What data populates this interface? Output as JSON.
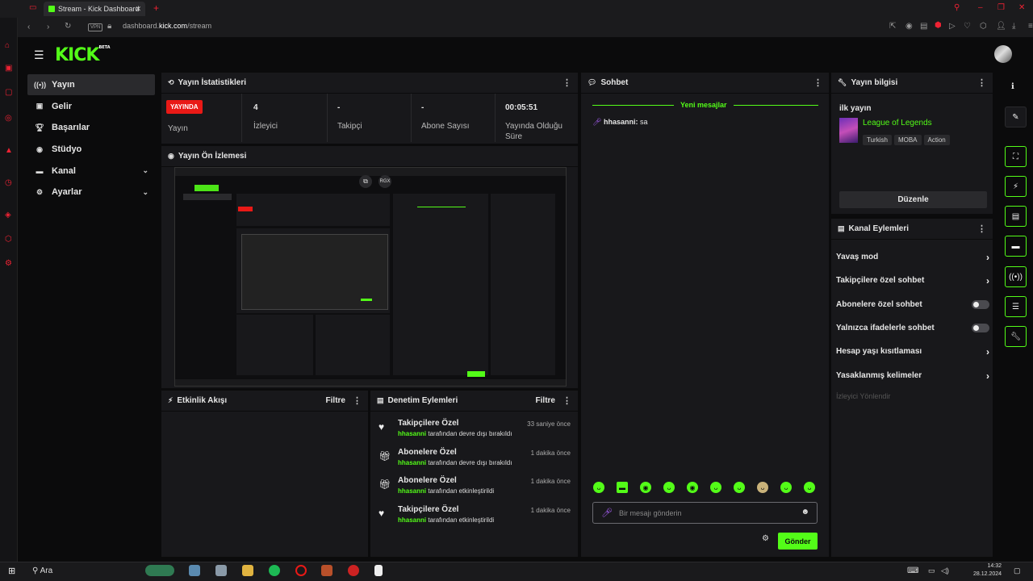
{
  "browser": {
    "tab_title": "Stream - Kick Dashboard",
    "new_tab": "+",
    "url_prefix": "dashboard.",
    "url_domain": "kick.com",
    "url_path": "/stream",
    "vpn_label": "VPN"
  },
  "brand": {
    "logo": "KICK",
    "beta": "BETA",
    "accent": "#53fc18",
    "live_red": "#e91916"
  },
  "sidebar": {
    "items": [
      {
        "label": "Yayın",
        "icon": "broadcast-icon"
      },
      {
        "label": "Gelir",
        "icon": "money-icon"
      },
      {
        "label": "Başarılar",
        "icon": "trophy-icon"
      },
      {
        "label": "Stüdyo",
        "icon": "studio-icon"
      },
      {
        "label": "Kanal",
        "icon": "channel-icon"
      },
      {
        "label": "Ayarlar",
        "icon": "gear-icon"
      }
    ]
  },
  "stats": {
    "title": "Yayın İstatistikleri",
    "live_badge": "YAYINDA",
    "live_label": "Yayın",
    "viewers_value": "4",
    "viewers_label": "İzleyici",
    "followers_value": "-",
    "followers_label": "Takipçi",
    "subs_value": "-",
    "subs_label": "Abone Sayısı",
    "uptime_value": "00:05:51",
    "uptime_label": "Yayında Olduğu Süre"
  },
  "preview": {
    "title": "Yayın Ön İzlemesi",
    "rgx_label": "RGX"
  },
  "activity": {
    "title": "Etkinlik Akışı",
    "filter": "Filtre"
  },
  "mod_actions": {
    "title": "Denetim Eylemleri",
    "filter": "Filtre",
    "rows": [
      {
        "title": "Takipçilere Özel",
        "user": "hhasanni",
        "desc": "tarafından devre dışı bırakıldı",
        "time": "33 saniye önce",
        "icon": "heart-icon"
      },
      {
        "title": "Abonelere Özel",
        "user": "hhasanni",
        "desc": "tarafından devre dışı bırakıldı",
        "time": "1 dakika önce",
        "icon": "gift-icon"
      },
      {
        "title": "Abonelere Özel",
        "user": "hhasanni",
        "desc": "tarafından etkinleştirildi",
        "time": "1 dakika önce",
        "icon": "gift-icon"
      },
      {
        "title": "Takipçilere Özel",
        "user": "hhasanni",
        "desc": "tarafından etkinleştirildi",
        "time": "1 dakika önce",
        "icon": "heart-icon"
      }
    ]
  },
  "chat": {
    "title": "Sohbet",
    "new_messages": "Yeni mesajlar",
    "messages": [
      {
        "user": "hhasanni:",
        "text": "sa"
      }
    ],
    "placeholder": "Bir mesajı gönderin",
    "send": "Gönder"
  },
  "stream_info": {
    "title": "Yayın bilgisi",
    "stream_title": "ilk yayın",
    "category": "League of Legends",
    "tags": [
      "Turkish",
      "MOBA",
      "Action"
    ],
    "edit_button": "Düzenle"
  },
  "channel_actions": {
    "title": "Kanal Eylemleri",
    "items": [
      {
        "label": "Yavaş mod",
        "control": "arrow"
      },
      {
        "label": "Takipçilere özel sohbet",
        "control": "arrow"
      },
      {
        "label": "Abonelere özel sohbet",
        "control": "toggle",
        "on": false
      },
      {
        "label": "Yalnızca ifadelerle sohbet",
        "control": "toggle",
        "on": false
      },
      {
        "label": "Hesap yaşı kısıtlaması",
        "control": "arrow"
      },
      {
        "label": "Yasaklanmış kelimeler",
        "control": "arrow"
      }
    ],
    "redirect": "İzleyici Yönlendir"
  },
  "taskbar": {
    "search": "Ara",
    "time": "14:32",
    "date": "28.12.2024"
  }
}
